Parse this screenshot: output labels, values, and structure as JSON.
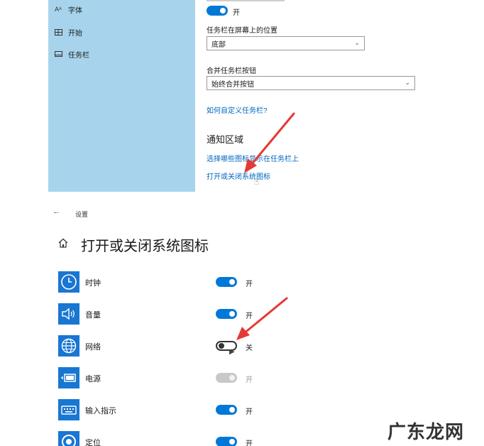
{
  "top": {
    "sidebar": {
      "items": [
        {
          "label": "字体",
          "icon": "font-icon"
        },
        {
          "label": "开始",
          "icon": "start-icon"
        },
        {
          "label": "任务栏",
          "icon": "taskbar-icon"
        }
      ]
    },
    "toggle_state": "开",
    "position_label": "任务栏在屏幕上的位置",
    "position_value": "底部",
    "combine_label": "合并任务栏按钮",
    "combine_value": "始终合并按钮",
    "customize_link": "如何自定义任务栏?",
    "notification_title": "通知区域",
    "select_icons_link": "选择哪些图标显示在任务栏上",
    "system_icons_link": "打开或关闭系统图标"
  },
  "bottom": {
    "settings_label": "设置",
    "page_title": "打开或关闭系统图标",
    "rows": [
      {
        "label": "时钟",
        "state": "开",
        "toggle": "on",
        "icon": "clock-icon"
      },
      {
        "label": "音量",
        "state": "开",
        "toggle": "on",
        "icon": "volume-icon"
      },
      {
        "label": "网络",
        "state": "关",
        "toggle": "off",
        "icon": "network-icon"
      },
      {
        "label": "电源",
        "state": "开",
        "toggle": "disabled",
        "icon": "power-icon"
      },
      {
        "label": "输入指示",
        "state": "开",
        "toggle": "on",
        "icon": "keyboard-icon"
      },
      {
        "label": "定位",
        "state": "开",
        "toggle": "on",
        "icon": "location-icon"
      }
    ]
  },
  "watermark": "广东龙网",
  "colors": {
    "accent": "#0078d7",
    "sidebar": "#a7d4ec",
    "icon_tile": "#1976d2",
    "link": "#0067c0",
    "annotation": "#e53935"
  }
}
